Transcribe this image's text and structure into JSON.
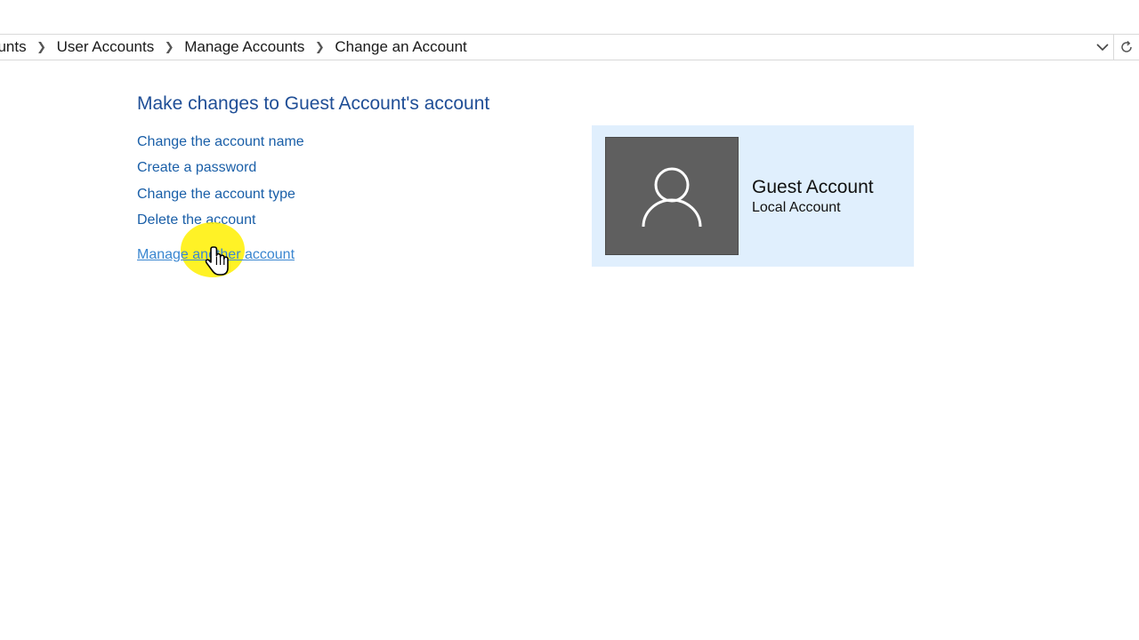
{
  "breadcrumb": {
    "items": [
      "ounts",
      "User Accounts",
      "Manage Accounts",
      "Change an Account"
    ]
  },
  "page": {
    "heading": "Make changes to Guest Account's account"
  },
  "tasks": {
    "change_name": "Change the account name",
    "create_password": "Create a password",
    "change_type": "Change the account type",
    "delete_account": "Delete the account",
    "manage_another": "Manage another account"
  },
  "account": {
    "name": "Guest Account",
    "type": "Local Account",
    "icon": "user-icon"
  },
  "colors": {
    "link": "#1a5fa8",
    "heading": "#1f4e96",
    "card_bg": "#e0effd",
    "avatar_bg": "#5f5f5f",
    "cursor_highlight": "#fff000"
  }
}
